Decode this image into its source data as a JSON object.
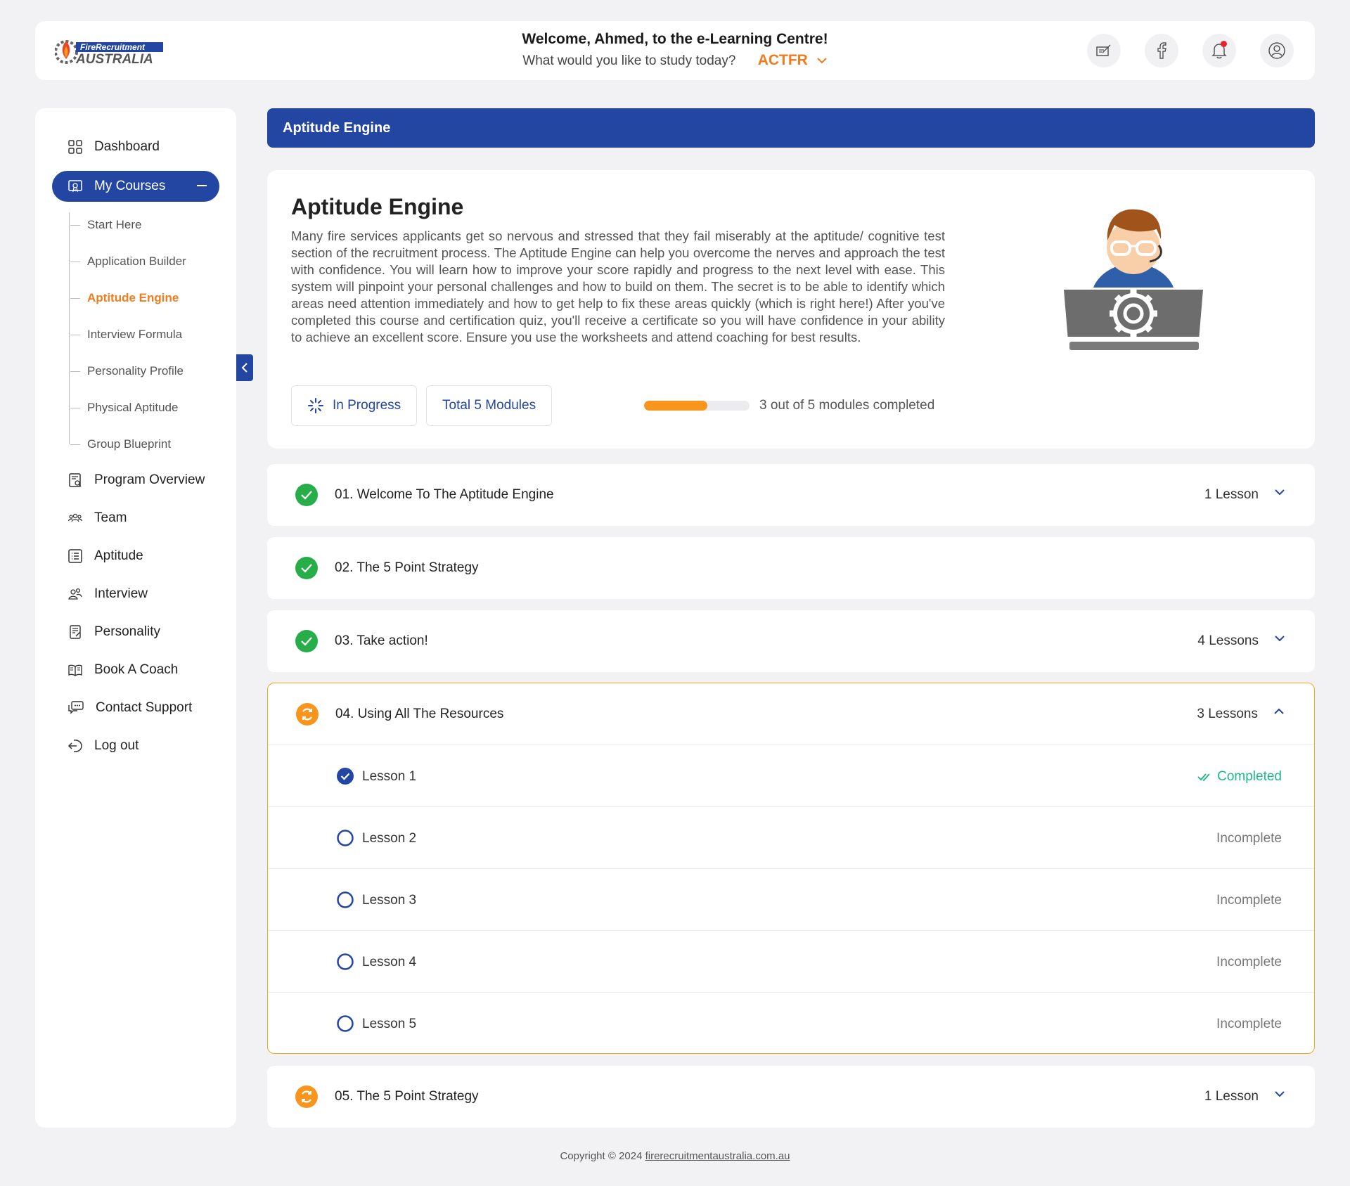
{
  "header": {
    "logo_text_top": "FireRecruitment",
    "logo_text_bottom": "AUSTRALIA",
    "welcome": "Welcome, Ahmed, to the e-Learning Centre!",
    "question": "What would you like to study today?",
    "course_select": "ACTFR",
    "icons": [
      "edit-icon",
      "facebook-icon",
      "bell-icon",
      "user-icon"
    ]
  },
  "sidebar": {
    "items": [
      {
        "label": "Dashboard",
        "icon": "dashboard-icon"
      },
      {
        "label": "My Courses",
        "icon": "courses-icon"
      },
      {
        "label": "Program Overview",
        "icon": "program-icon"
      },
      {
        "label": "Team",
        "icon": "team-icon"
      },
      {
        "label": "Aptitude",
        "icon": "list-icon"
      },
      {
        "label": "Interview",
        "icon": "interview-icon"
      },
      {
        "label": "Personality",
        "icon": "personality-icon"
      },
      {
        "label": "Book A Coach",
        "icon": "book-icon"
      },
      {
        "label": "Contact Support",
        "icon": "chat-icon"
      },
      {
        "label": "Log out",
        "icon": "logout-icon"
      }
    ],
    "sub_items": [
      {
        "label": "Start Here"
      },
      {
        "label": "Application Builder"
      },
      {
        "label": "Aptitude Engine",
        "active": true
      },
      {
        "label": "Interview Formula"
      },
      {
        "label": "Personality Profile"
      },
      {
        "label": "Physical Aptitude"
      },
      {
        "label": "Group Blueprint"
      }
    ]
  },
  "banner": {
    "title": "Aptitude Engine"
  },
  "course": {
    "title": "Aptitude Engine",
    "description": "Many fire services applicants get so nervous and stressed that they fail miserably at the aptitude/ cognitive test section of the recruitment process. The Aptitude Engine can help you overcome the nerves and approach the test with confidence. You will learn how to improve your score rapidly and progress to the next level with ease. This system will pinpoint your personal challenges and how to build on them. The secret is to be able to identify which areas need attention immediately and how to get help to fix these areas quickly (which is right here!) After you've completed this course and certification quiz, you'll receive a certificate so you will have confidence in your ability to achieve an excellent score. Ensure you use the worksheets and attend coaching for best results.",
    "status": "In Progress",
    "total_modules": "Total 5 Modules",
    "progress_fraction": 0.6,
    "progress_text": "3 out of 5 modules  completed"
  },
  "modules": [
    {
      "title": "01. Welcome To The Aptitude Engine",
      "lessons": "1 Lesson",
      "status": "complete"
    },
    {
      "title": "02. The 5 Point Strategy",
      "lessons": "",
      "status": "complete"
    },
    {
      "title": "03. Take action!",
      "lessons": "4 Lessons",
      "status": "complete"
    },
    {
      "title": "04. Using All The Resources",
      "lessons": "3 Lessons",
      "status": "in-progress"
    },
    {
      "title": "05. The 5 Point Strategy",
      "lessons": "1 Lesson",
      "status": "in-progress"
    }
  ],
  "open_module_lessons": [
    {
      "label": "Lesson 1",
      "status": "Completed"
    },
    {
      "label": "Lesson 2",
      "status": "Incomplete"
    },
    {
      "label": "Lesson 3",
      "status": "Incomplete"
    },
    {
      "label": "Lesson 4",
      "status": "Incomplete"
    },
    {
      "label": "Lesson 5",
      "status": "Incomplete"
    }
  ],
  "footer": {
    "copyright": "Copyright © 2024",
    "link": "firerecruitmentaustralia.com.au"
  },
  "colors": {
    "primary": "#2346a3",
    "accent": "#f07c1e",
    "progress": "#f9951d",
    "success": "#27ae48",
    "completed_text": "#1cb88a"
  }
}
